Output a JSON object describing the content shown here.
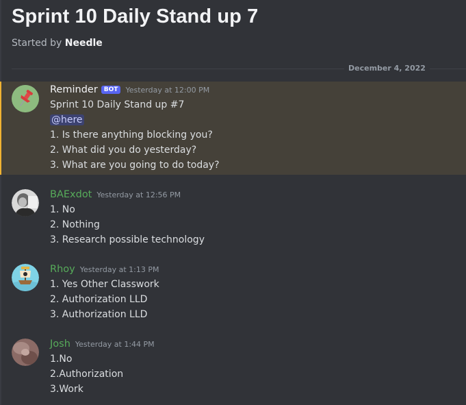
{
  "thread": {
    "title": "Sprint 10 Daily Stand up 7",
    "started_prefix": "Started by ",
    "started_by": "Needle"
  },
  "date_divider": "December 4, 2022",
  "colors": {
    "background": "#313338",
    "highlight_bg": "#454139",
    "highlight_border": "#f0b232",
    "bot_tag": "#5865f2",
    "username_green": "#57ab5a",
    "username_default": "#f2f3f5"
  },
  "messages": [
    {
      "username": "Reminder",
      "bot_tag": "BOT",
      "timestamp": "Yesterday at 12:00 PM",
      "avatar_icon": "pushpin-icon",
      "lines": [
        "Sprint 10 Daily Stand up #7"
      ],
      "mention": "@here",
      "lines_after": [
        "1. Is there anything blocking you?",
        "2. What did you do yesterday?",
        "3. What are you going to do today?"
      ]
    },
    {
      "username": "BAExdot",
      "timestamp": "Yesterday at 12:56 PM",
      "lines": [
        "1. No",
        "2. Nothing",
        "3. Research possible technology"
      ]
    },
    {
      "username": "Rhoy",
      "timestamp": "Yesterday at 1:13 PM",
      "lines": [
        "1. Yes Other Classwork",
        "2. Authorization LLD",
        "3. Authorization LLD"
      ]
    },
    {
      "username": "Josh",
      "timestamp": "Yesterday at 1:44 PM",
      "lines": [
        "1.No",
        "2.Authorization",
        "3.Work"
      ]
    }
  ]
}
